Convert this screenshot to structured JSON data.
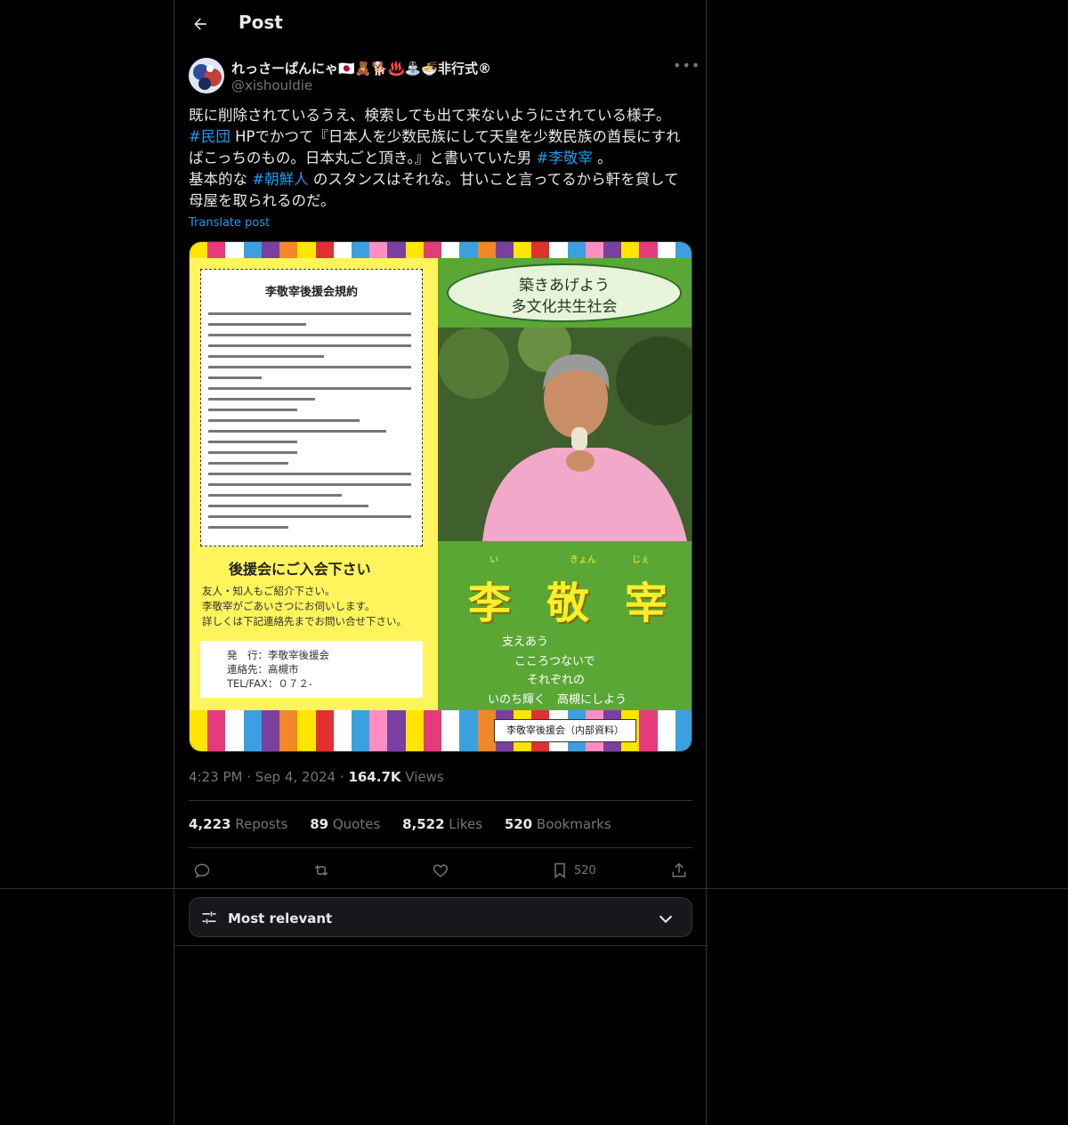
{
  "header": {
    "title": "Post"
  },
  "author": {
    "name": "れっさーぱんにゃ🇯🇵🧸🐕♨️⛲🍜非行式®",
    "handle": "@xishouldie"
  },
  "tweet": {
    "line1": "既に削除されているうえ、検索しても出て来ないようにされている様子。",
    "tag1": "#民団",
    "line2a": " HPでかつて『日本人を少数民族にして天皇を少数民族の酋長にすれ",
    "line2b": "ばこっちのもの。日本丸ごと頂き。』と書いていた男 ",
    "tag2": "#李敬宰",
    "line2c": " 。",
    "line3a": "基本的な ",
    "tag3": "#朝鮮人",
    "line3b": " のスタンスはそれな。甘いこと言ってるから軒を貸して",
    "line4": "母屋を取られるのだ。",
    "translate": "Translate post"
  },
  "image": {
    "rules_title": "李敬宰後援会規約",
    "join_heading": "後援会にご入会下さい",
    "join_lines": [
      "友人・知人もご紹介下さい。",
      "李敬宰がごあいさつにお伺いします。",
      "詳しくは下記連絡先までお問い合せ下さい。"
    ],
    "pub_lines": [
      "発　行：李敬宰後援会",
      "連絡先：高槻市",
      "TEL/FAX：０７２-"
    ],
    "slogan_1": "築きあげよう",
    "slogan_2": "多文化共生社会",
    "name_chars": "李敬宰",
    "ruby": [
      "い",
      "きょん",
      "じぇ"
    ],
    "poem": [
      "支えあう",
      "こころつないで",
      "それぞれの",
      "いのち輝く　高槻にしよう"
    ],
    "internal": "李敬宰後援会（内部資料）"
  },
  "meta": {
    "time": "4:23 PM",
    "dot": "·",
    "date": "Sep 4, 2024",
    "views_count": "164.7K",
    "views_label": "Views"
  },
  "stats": {
    "reposts": "4,223",
    "reposts_label": "Reposts",
    "quotes": "89",
    "quotes_label": "Quotes",
    "likes": "8,522",
    "likes_label": "Likes",
    "bookmarks": "520",
    "bookmarks_label": "Bookmarks"
  },
  "actions": {
    "bookmark_count": "520"
  },
  "sort": {
    "label": "Most relevant"
  },
  "colors": {
    "accent": "#1d9bf0",
    "bg": "#000000",
    "muted": "#71767b"
  }
}
